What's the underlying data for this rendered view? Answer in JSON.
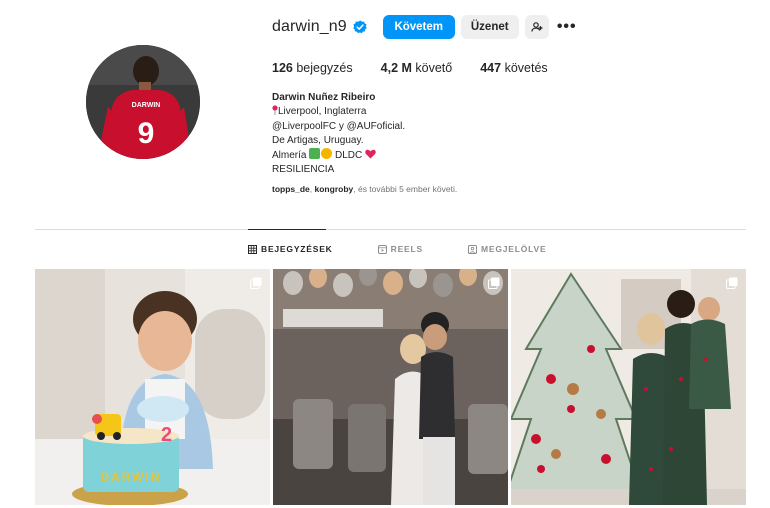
{
  "profile": {
    "username": "darwin_n9",
    "follow_label": "Követem",
    "message_label": "Üzenet",
    "more_label": "•••",
    "stats": {
      "posts_value": "126",
      "posts_label": "bejegyzés",
      "followers_value": "4,2 M",
      "followers_label": "követő",
      "following_value": "447",
      "following_label": "követés"
    },
    "bio": {
      "name": "Darwin Nuñez Ribeiro",
      "line1": "Liverpool, Inglaterra",
      "line2": "@LiverpoolFC y @AUFoficial.",
      "line3": "De Artigas, Uruguay.",
      "line4_prefix": "Almería",
      "line4_dldc": "DLDC",
      "line5": "RESILIENCIA"
    },
    "followed_by": {
      "user1": "topps_de",
      "sep": ", ",
      "user2": "kongroby",
      "rest": ", és további 5 ember követi."
    },
    "avatar_jersey_name": "DARWIN",
    "avatar_jersey_number": "9"
  },
  "tabs": [
    {
      "label": "BEJEGYZÉSEK",
      "icon": "grid-icon",
      "active": true
    },
    {
      "label": "REELS",
      "icon": "reels-icon",
      "active": false
    },
    {
      "label": "MEGJELÖLVE",
      "icon": "tagged-icon",
      "active": false
    }
  ],
  "posts": [
    {
      "cake_text": "DARWIN",
      "cake_number": "2",
      "icon": "carousel-icon"
    },
    {
      "icon": "carousel-icon"
    },
    {
      "icon": "carousel-icon"
    }
  ],
  "colors": {
    "accent": "#0095f6",
    "liverpool_red": "#c8102e"
  }
}
